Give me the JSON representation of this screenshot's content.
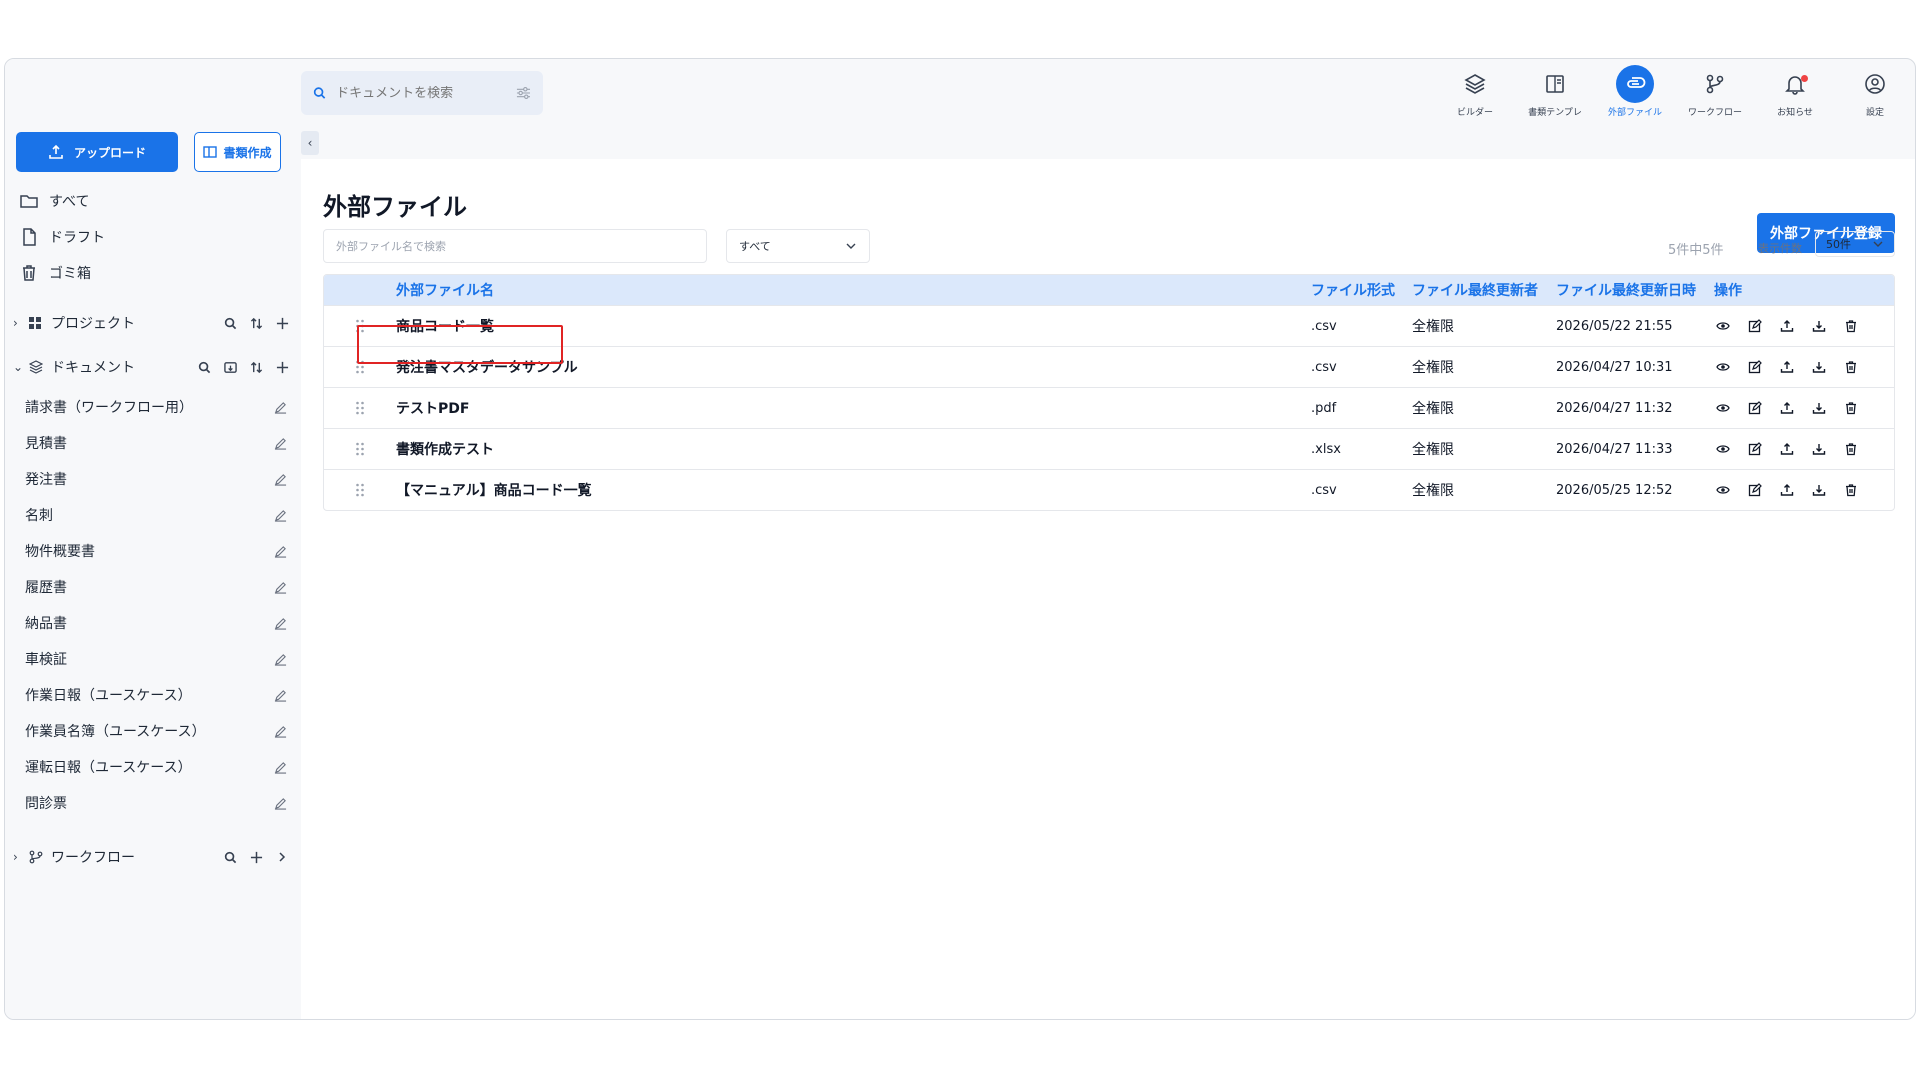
{
  "colors": {
    "accent": "#1a73e8",
    "highlight": "#e02424",
    "header_bg": "#dbe8fb"
  },
  "sidebar": {
    "upload_label": "アップロード",
    "create_label": "書類作成",
    "nav": [
      {
        "label": "すべて",
        "icon": "folder-icon"
      },
      {
        "label": "ドラフト",
        "icon": "file-icon"
      },
      {
        "label": "ゴミ箱",
        "icon": "trash-icon"
      }
    ],
    "projects_label": "プロジェクト",
    "documents_label": "ドキュメント",
    "documents": [
      "請求書（ワークフロー用）",
      "見積書",
      "発注書",
      "名刺",
      "物件概要書",
      "履歴書",
      "納品書",
      "車検証",
      "作業日報（ユースケース）",
      "作業員名簿（ユースケース）",
      "運転日報（ユースケース）",
      "問診票"
    ],
    "workflow_label": "ワークフロー"
  },
  "search": {
    "placeholder": "ドキュメントを検索"
  },
  "topnav": [
    {
      "label": "ビルダー",
      "icon": "layers-icon"
    },
    {
      "label": "書類テンプレ",
      "icon": "template-icon"
    },
    {
      "label": "外部ファイル",
      "icon": "paperclip-icon",
      "active": true
    },
    {
      "label": "ワークフロー",
      "icon": "workflow-icon"
    },
    {
      "label": "お知らせ",
      "icon": "bell-icon"
    },
    {
      "label": "設定",
      "icon": "user-circle-icon"
    }
  ],
  "main": {
    "title": "外部ファイル",
    "register_label": "外部ファイル登録",
    "filter_placeholder": "外部ファイル名で検索",
    "filter_select": "すべて",
    "count": "5件中5件",
    "perpage_label": "表示件数",
    "perpage_value": "50件"
  },
  "table": {
    "headers": [
      "外部ファイル名",
      "ファイル形式",
      "ファイル最終更新者",
      "ファイル最終更新日時",
      "操作"
    ],
    "rows": [
      {
        "name": "商品コード一覧",
        "format": ".csv",
        "user": "全権限",
        "date": "2026/05/22 21:55"
      },
      {
        "name": "発注書マスタデータサンプル",
        "format": ".csv",
        "user": "全権限",
        "date": "2026/04/27 10:31"
      },
      {
        "name": "テストPDF",
        "format": ".pdf",
        "user": "全権限",
        "date": "2026/04/27 11:32"
      },
      {
        "name": "書類作成テスト",
        "format": ".xlsx",
        "user": "全権限",
        "date": "2026/04/27 11:33"
      },
      {
        "name": "【マニュアル】商品コード一覧",
        "format": ".csv",
        "user": "全権限",
        "date": "2026/05/25 12:52",
        "highlighted": true
      }
    ]
  }
}
